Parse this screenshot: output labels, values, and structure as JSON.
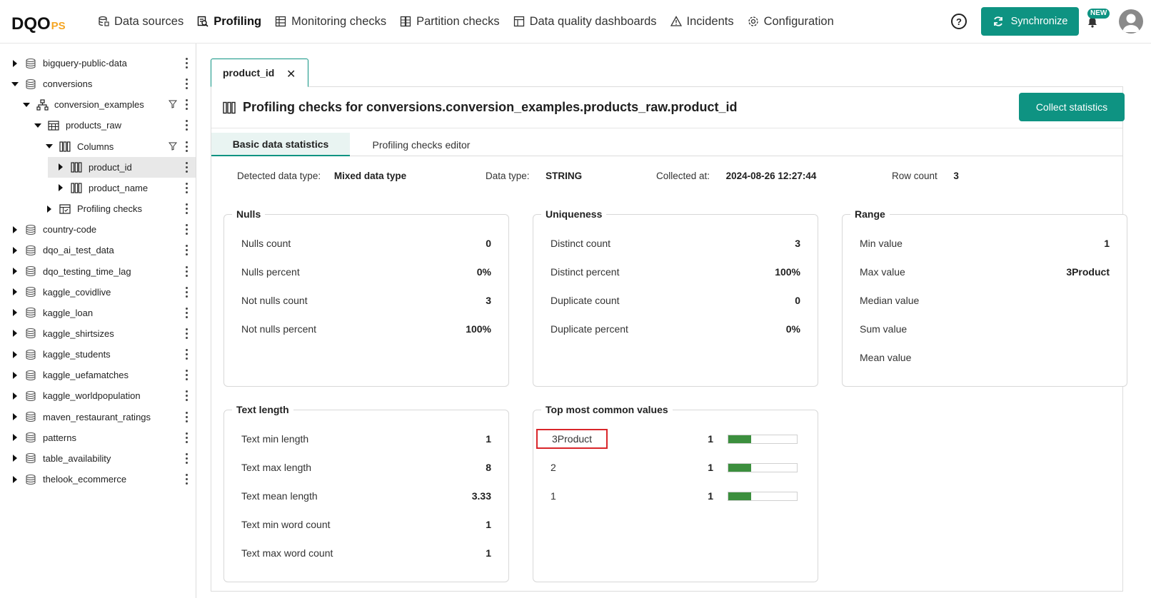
{
  "app": {
    "logo_main": "DQO",
    "logo_suffix": "PS"
  },
  "nav": [
    {
      "label": "Data sources",
      "icon": "data-sources-icon"
    },
    {
      "label": "Profiling",
      "icon": "profiling-icon",
      "active": true
    },
    {
      "label": "Monitoring checks",
      "icon": "monitoring-icon"
    },
    {
      "label": "Partition checks",
      "icon": "partition-icon"
    },
    {
      "label": "Data quality dashboards",
      "icon": "dashboard-icon"
    },
    {
      "label": "Incidents",
      "icon": "warning-icon"
    },
    {
      "label": "Configuration",
      "icon": "gear-icon"
    }
  ],
  "header": {
    "help": "?",
    "sync_label": "Synchronize",
    "new_badge": "NEW"
  },
  "sidebar": {
    "items": [
      {
        "label": "bigquery-public-data",
        "level": 0,
        "expanded": false,
        "type": "database"
      },
      {
        "label": "conversions",
        "level": 0,
        "expanded": true,
        "type": "database"
      },
      {
        "label": "conversion_examples",
        "level": 1,
        "expanded": true,
        "type": "schema",
        "filter": true
      },
      {
        "label": "products_raw",
        "level": 2,
        "expanded": true,
        "type": "table"
      },
      {
        "label": "Columns",
        "level": 3,
        "expanded": true,
        "type": "columns",
        "filter": true
      },
      {
        "label": "product_id",
        "level": 4,
        "expanded": false,
        "type": "column",
        "selected": true
      },
      {
        "label": "product_name",
        "level": 4,
        "expanded": false,
        "type": "column"
      },
      {
        "label": "Profiling checks",
        "level": 3,
        "expanded": false,
        "type": "checks"
      },
      {
        "label": "country-code",
        "level": 0,
        "expanded": false,
        "type": "database"
      },
      {
        "label": "dqo_ai_test_data",
        "level": 0,
        "expanded": false,
        "type": "database"
      },
      {
        "label": "dqo_testing_time_lag",
        "level": 0,
        "expanded": false,
        "type": "database"
      },
      {
        "label": "kaggle_covidlive",
        "level": 0,
        "expanded": false,
        "type": "database"
      },
      {
        "label": "kaggle_loan",
        "level": 0,
        "expanded": false,
        "type": "database"
      },
      {
        "label": "kaggle_shirtsizes",
        "level": 0,
        "expanded": false,
        "type": "database"
      },
      {
        "label": "kaggle_students",
        "level": 0,
        "expanded": false,
        "type": "database"
      },
      {
        "label": "kaggle_uefamatches",
        "level": 0,
        "expanded": false,
        "type": "database"
      },
      {
        "label": "kaggle_worldpopulation",
        "level": 0,
        "expanded": false,
        "type": "database"
      },
      {
        "label": "maven_restaurant_ratings",
        "level": 0,
        "expanded": false,
        "type": "database"
      },
      {
        "label": "patterns",
        "level": 0,
        "expanded": false,
        "type": "database"
      },
      {
        "label": "table_availability",
        "level": 0,
        "expanded": false,
        "type": "database"
      },
      {
        "label": "thelook_ecommerce",
        "level": 0,
        "expanded": false,
        "type": "database"
      }
    ]
  },
  "tab": {
    "label": "product_id",
    "close": "✕"
  },
  "main": {
    "title": "Profiling checks for conversions.conversion_examples.products_raw.product_id",
    "collect_label": "Collect statistics",
    "subtabs": [
      "Basic data statistics",
      "Profiling checks editor"
    ],
    "meta": {
      "detected_label": "Detected data type:",
      "detected_value": "Mixed data type",
      "datatype_label": "Data type:",
      "datatype_value": "STRING",
      "collected_label": "Collected at:",
      "collected_value": "2024-08-26 12:27:44",
      "rowcount_label": "Row count",
      "rowcount_value": "3"
    },
    "nulls": {
      "title": "Nulls",
      "rows": [
        {
          "label": "Nulls count",
          "value": "0"
        },
        {
          "label": "Nulls percent",
          "value": "0%"
        },
        {
          "label": "Not nulls count",
          "value": "3"
        },
        {
          "label": "Not nulls percent",
          "value": "100%"
        }
      ]
    },
    "uniqueness": {
      "title": "Uniqueness",
      "rows": [
        {
          "label": "Distinct count",
          "value": "3"
        },
        {
          "label": "Distinct percent",
          "value": "100%"
        },
        {
          "label": "Duplicate count",
          "value": "0"
        },
        {
          "label": "Duplicate percent",
          "value": "0%"
        }
      ]
    },
    "range": {
      "title": "Range",
      "rows": [
        {
          "label": "Min value",
          "value": "1"
        },
        {
          "label": "Max value",
          "value": "3Product"
        },
        {
          "label": "Median value",
          "value": ""
        },
        {
          "label": "Sum value",
          "value": ""
        },
        {
          "label": "Mean value",
          "value": ""
        }
      ]
    },
    "text_length": {
      "title": "Text length",
      "rows": [
        {
          "label": "Text min length",
          "value": "1"
        },
        {
          "label": "Text max length",
          "value": "8"
        },
        {
          "label": "Text mean length",
          "value": "3.33"
        },
        {
          "label": "Text min word count",
          "value": "1"
        },
        {
          "label": "Text max word count",
          "value": "1"
        }
      ]
    },
    "top_values": {
      "title": "Top most common values",
      "rows": [
        {
          "label": "3Product",
          "count": "1",
          "fraction": 0.33,
          "highlighted": true
        },
        {
          "label": "2",
          "count": "1",
          "fraction": 0.33
        },
        {
          "label": "1",
          "count": "1",
          "fraction": 0.33
        }
      ]
    }
  },
  "colors": {
    "accent": "#0e9382",
    "bar": "#3c8f3e",
    "highlight": "#d9262a"
  }
}
